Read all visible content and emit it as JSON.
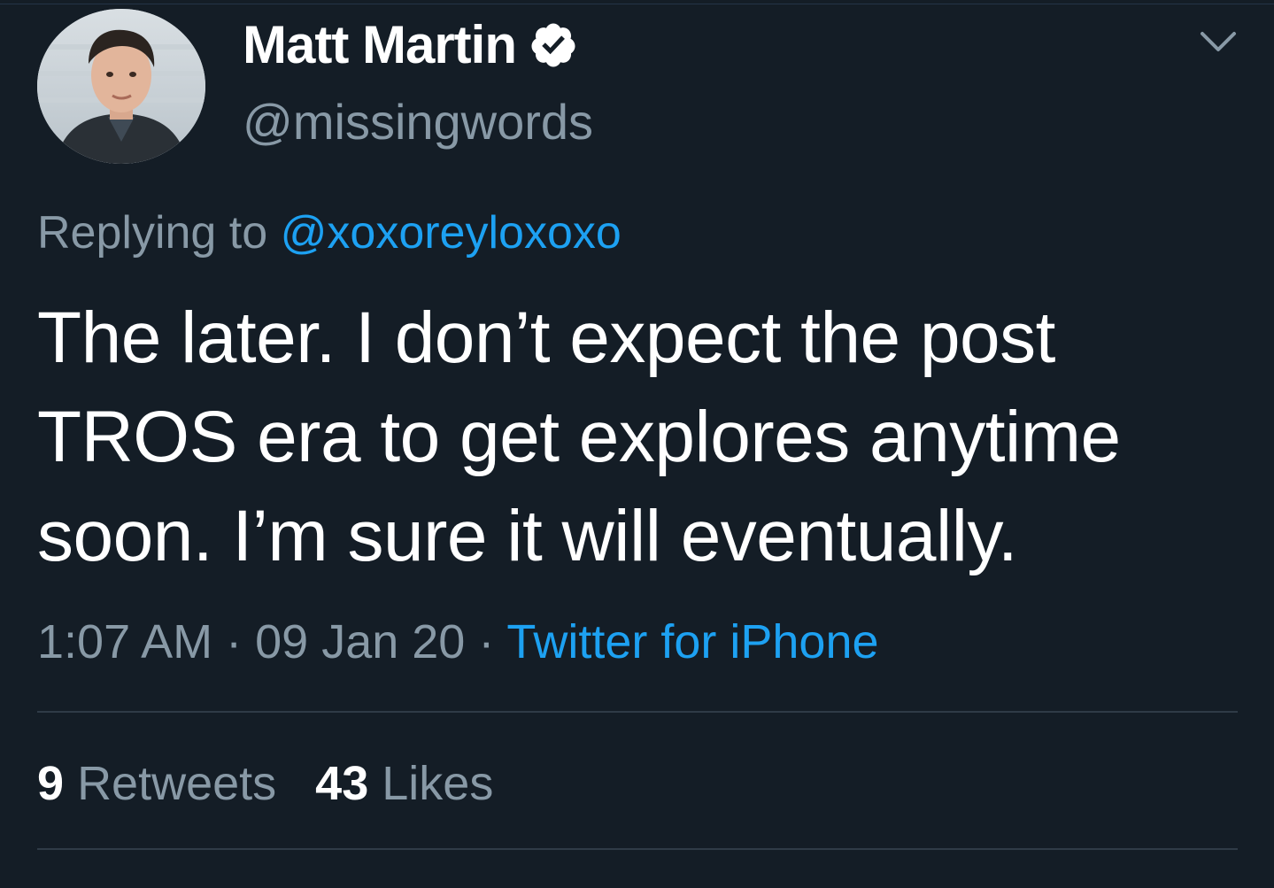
{
  "tweet": {
    "display_name": "Matt Martin",
    "handle": "@missingwords",
    "replying_prefix": "Replying to ",
    "replying_to": "@xoxoreyloxoxo",
    "text": "The later. I don’t expect the post TROS era to get explores anytime soon. I’m sure it will eventually.",
    "time": "1:07 AM",
    "separator": " · ",
    "date": "09 Jan 20",
    "source": "Twitter for iPhone",
    "retweets_count": "9",
    "retweets_label": "Retweets",
    "likes_count": "43",
    "likes_label": "Likes"
  },
  "icons": {
    "verified": "verified-badge-icon",
    "menu": "chevron-down-icon"
  },
  "colors": {
    "background": "#141d26",
    "primary_text": "#ffffff",
    "secondary_text": "#8899a6",
    "link": "#1da1f2",
    "divider": "#2f3b47"
  }
}
